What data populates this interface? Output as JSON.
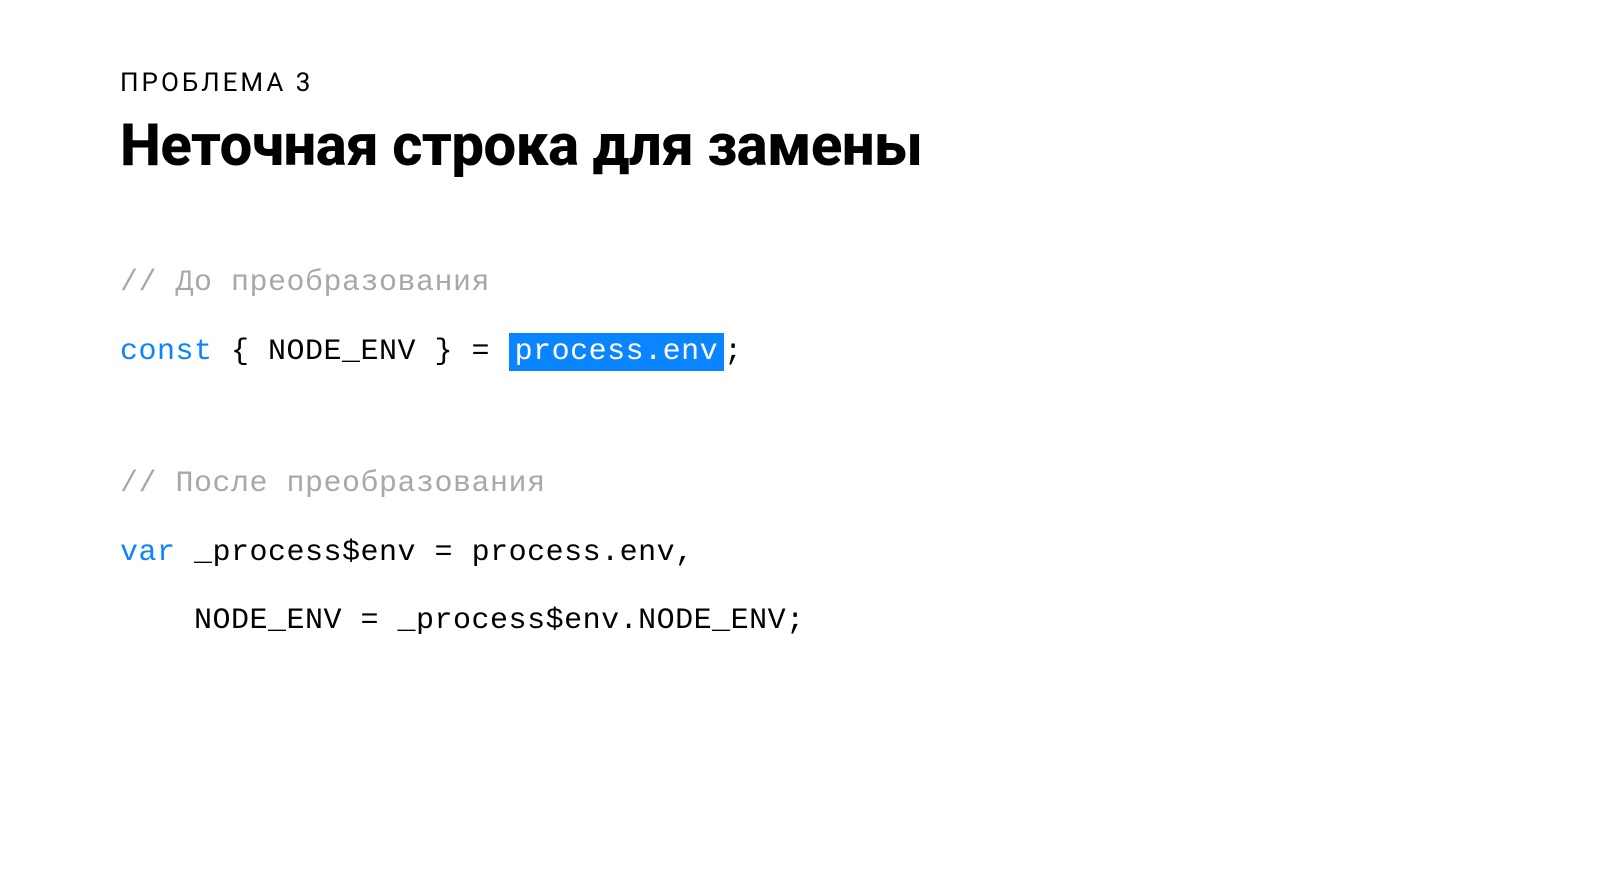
{
  "eyebrow": "ПРОБЛЕМА 3",
  "title": "Неточная строка для замены",
  "code": {
    "before": {
      "comment": "// До преобразования",
      "line1": {
        "kw": "const",
        "open": " { NODE_ENV } = ",
        "highlight": "process.env",
        "close": ";"
      }
    },
    "after": {
      "comment": "// После преобразования",
      "line1": {
        "kw": "var",
        "rest": " _process$env = process.env,"
      },
      "line2": "    NODE_ENV = _process$env.NODE_ENV;"
    }
  }
}
